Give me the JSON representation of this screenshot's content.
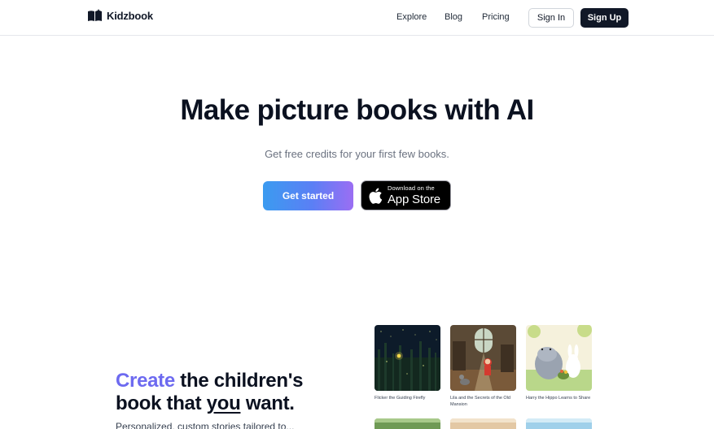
{
  "header": {
    "logo_text": "Kidzbook",
    "nav": [
      "Explore",
      "Blog",
      "Pricing"
    ],
    "signin_label": "Sign In",
    "signup_label": "Sign Up"
  },
  "hero": {
    "title": "Make picture books with AI",
    "subtitle": "Get free credits for your first few books.",
    "cta_label": "Get started",
    "appstore_small": "Download on the",
    "appstore_big": "App Store"
  },
  "section": {
    "title_accent": "Create",
    "title_rest1": " the children's",
    "title_line2_pre": "book that ",
    "title_line2_underline": "you",
    "title_line2_post": " want.",
    "description": "Personalized, custom stories tailored to..."
  },
  "books": [
    {
      "title": "Flicker the Guiding Firefly"
    },
    {
      "title": "Lila and the Secrets of the Old Mansion"
    },
    {
      "title": "Harry the Hippo Learns to Share"
    }
  ],
  "colors": {
    "accent": "#6d6af0",
    "dark": "#111827",
    "gradient_start": "#3b9bf0",
    "gradient_end": "#9b6ef3"
  },
  "icons": [
    "book-logo-icon",
    "apple-icon"
  ]
}
